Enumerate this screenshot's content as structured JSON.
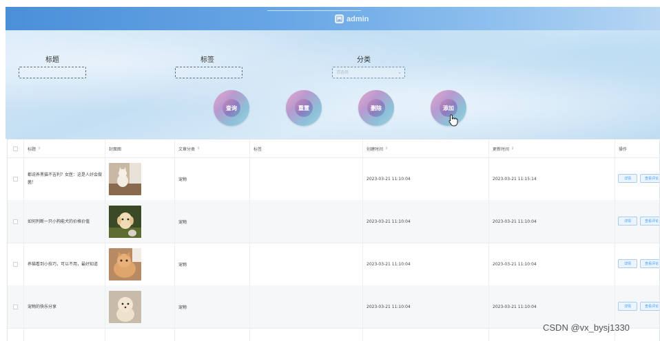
{
  "header": {
    "username": "admin"
  },
  "search": {
    "title_label": "标题",
    "tags_label": "标签",
    "category_label": "分类",
    "category_placeholder": "请选择",
    "buttons": {
      "query": "查询",
      "reset": "重置",
      "delete": "删除",
      "add": "添加"
    }
  },
  "table": {
    "columns": [
      "标题",
      "封面图",
      "文章分类",
      "标签",
      "创建时间",
      "更新时间",
      "操作"
    ],
    "sortable_marker": "⇕",
    "rows": [
      {
        "title": "都说养黑猫不吉利？女医：这是人好会做菌！",
        "category": "宠物",
        "tags": "",
        "created": "2023-03-21 11:10:04",
        "updated": "2023-03-21 11:15:14"
      },
      {
        "title": "如何判断一只小狗能犬的价格价值",
        "category": "宠物",
        "tags": "",
        "created": "2023-03-21 11:10:04",
        "updated": "2023-03-21 11:10:04"
      },
      {
        "title": "养猫看到小技巧，可以不用，最好知道",
        "category": "宠物",
        "tags": "",
        "created": "2023-03-21 11:10:04",
        "updated": "2023-03-21 11:10:04"
      },
      {
        "title": "宠物的快乐分享",
        "category": "宠物",
        "tags": "",
        "created": "2023-03-21 11:10:04",
        "updated": "2023-03-21 11:10:04"
      }
    ],
    "actions": {
      "detail": "详情",
      "comments": "查看评论"
    }
  },
  "watermark": "CSDN @vx_bysj1330",
  "colors": {
    "accent": "#409eff",
    "topbar": "#4a8fd8"
  }
}
